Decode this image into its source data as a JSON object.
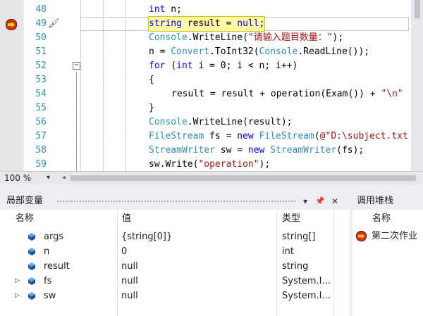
{
  "editor": {
    "lines": [
      {
        "num": "48",
        "segments": [
          {
            "t": "int",
            "c": "kw"
          },
          {
            "t": " n;",
            "c": ""
          }
        ]
      },
      {
        "num": "49",
        "segments": [
          {
            "t": "string",
            "c": "kw"
          },
          {
            "t": " result = ",
            "c": ""
          },
          {
            "t": "null",
            "c": "kw"
          },
          {
            "t": ";",
            "c": ""
          }
        ],
        "highlight": true
      },
      {
        "num": "50",
        "segments": [
          {
            "t": "Console",
            "c": "ty"
          },
          {
            "t": ".WriteLine(",
            "c": ""
          },
          {
            "t": "\"请输入题目数量：\"",
            "c": "str"
          },
          {
            "t": ");",
            "c": ""
          }
        ]
      },
      {
        "num": "51",
        "segments": [
          {
            "t": "n = ",
            "c": ""
          },
          {
            "t": "Convert",
            "c": "ty"
          },
          {
            "t": ".ToInt32(",
            "c": ""
          },
          {
            "t": "Console",
            "c": "ty"
          },
          {
            "t": ".ReadLine());",
            "c": ""
          }
        ]
      },
      {
        "num": "52",
        "segments": [
          {
            "t": "for",
            "c": "kw"
          },
          {
            "t": " (",
            "c": ""
          },
          {
            "t": "int",
            "c": "kw"
          },
          {
            "t": " i = 0; i < n; i++)",
            "c": ""
          }
        ]
      },
      {
        "num": "53",
        "segments": [
          {
            "t": "{",
            "c": ""
          }
        ]
      },
      {
        "num": "54",
        "segments": [
          {
            "t": "    result = result + operation(Exam()) + ",
            "c": ""
          },
          {
            "t": "\"\\n\"",
            "c": "str"
          }
        ]
      },
      {
        "num": "55",
        "segments": [
          {
            "t": "}",
            "c": ""
          }
        ]
      },
      {
        "num": "56",
        "segments": [
          {
            "t": "Console",
            "c": "ty"
          },
          {
            "t": ".WriteLine(result);",
            "c": ""
          }
        ]
      },
      {
        "num": "57",
        "segments": [
          {
            "t": "FileStream",
            "c": "ty"
          },
          {
            "t": " fs = ",
            "c": ""
          },
          {
            "t": "new",
            "c": "kw"
          },
          {
            "t": " ",
            "c": ""
          },
          {
            "t": "FileStream",
            "c": "ty"
          },
          {
            "t": "(",
            "c": ""
          },
          {
            "t": "@\"D:\\subject.txt",
            "c": "str"
          }
        ]
      },
      {
        "num": "58",
        "segments": [
          {
            "t": "StreamWriter",
            "c": "ty"
          },
          {
            "t": " sw = ",
            "c": ""
          },
          {
            "t": "new",
            "c": "kw"
          },
          {
            "t": " ",
            "c": ""
          },
          {
            "t": "StreamWriter",
            "c": "ty"
          },
          {
            "t": "(fs);",
            "c": ""
          }
        ]
      },
      {
        "num": "59",
        "segments": [
          {
            "t": "sw.Write(",
            "c": ""
          },
          {
            "t": "\"operation\"",
            "c": "str"
          },
          {
            "t": ");",
            "c": ""
          }
        ]
      }
    ],
    "zoom": "100 %",
    "fold_symbol": "−",
    "dropdown_glyph": "▾",
    "left_arrow": "◂",
    "brush_glyph": "🖌"
  },
  "locals_panel": {
    "title": "局部变量",
    "dropdown": "▾",
    "pin": "📌",
    "close": "✕",
    "columns": {
      "name": "名称",
      "value": "值",
      "type": "类型"
    },
    "rows": [
      {
        "name": "args",
        "value": "{string[0]}",
        "type": "string[]",
        "expandable": false
      },
      {
        "name": "n",
        "value": "0",
        "type": "int",
        "expandable": false
      },
      {
        "name": "result",
        "value": "null",
        "type": "string",
        "expandable": false
      },
      {
        "name": "fs",
        "value": "null",
        "type": "System.I...",
        "expandable": true
      },
      {
        "name": "sw",
        "value": "null",
        "type": "System.I...",
        "expandable": true
      }
    ],
    "expander_glyph": "▷",
    "icon_color": "#1c62b9"
  },
  "callstack_panel": {
    "title": "调用堆栈",
    "column_name": "名称",
    "first_frame": "第二次作业"
  }
}
